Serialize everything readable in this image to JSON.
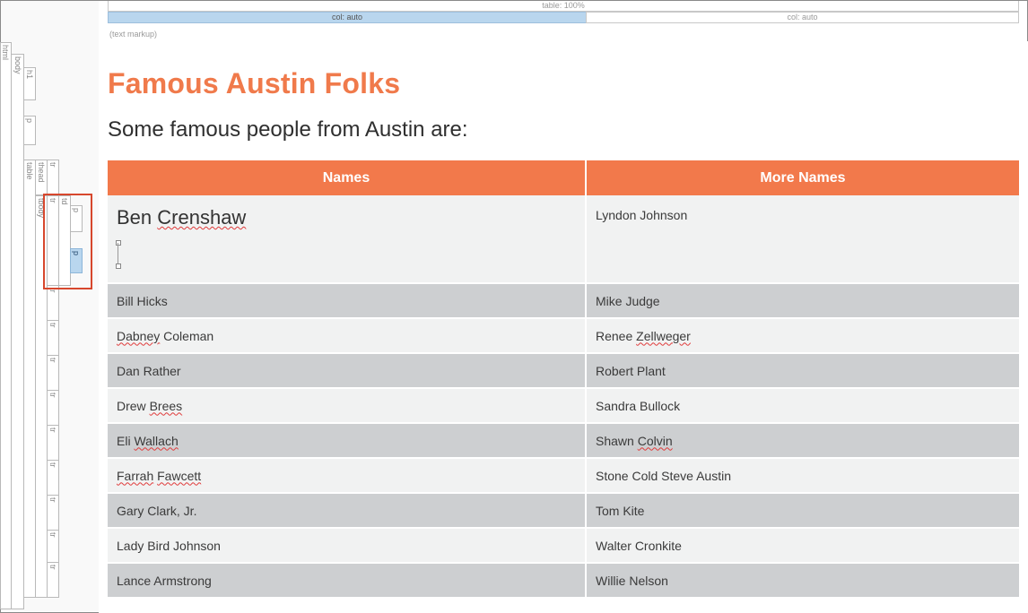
{
  "markup": {
    "table_label": "table: 100%",
    "col1_label": "col: auto",
    "col2_label": "col: auto",
    "text_markup_label": "(text markup)"
  },
  "structure_tags": {
    "html": "html",
    "body": "body",
    "h1": "h1",
    "p": "p",
    "table": "table",
    "thead": "thead",
    "tr": "tr",
    "tbody": "tbody",
    "td": "td"
  },
  "page": {
    "title": "Famous Austin Folks",
    "intro": "Some famous people from Austin are:"
  },
  "table": {
    "headers": [
      "Names",
      "More Names"
    ],
    "first_row": {
      "left_first": "Ben",
      "left_second": "Crenshaw",
      "right": "Lyndon Johnson"
    },
    "rows": [
      {
        "left": "Bill Hicks",
        "right": "Mike Judge"
      },
      {
        "left_a": "Dabney",
        "left_b": " Coleman",
        "right_a": "Renee ",
        "right_b": "Zellweger"
      },
      {
        "left": "Dan Rather",
        "right": "Robert Plant"
      },
      {
        "left_a": "Drew ",
        "left_b": "Brees",
        "right": "Sandra Bullock"
      },
      {
        "left_a": "Eli ",
        "left_b": "Wallach",
        "right_a": "Shawn ",
        "right_b": "Colvin"
      },
      {
        "left_a": "Farrah",
        "left_b": "Fawcett",
        "right": "Stone Cold Steve Austin"
      },
      {
        "left": "Gary Clark, Jr.",
        "right": "Tom Kite"
      },
      {
        "left": "Lady Bird Johnson",
        "right": "Walter Cronkite"
      },
      {
        "left": "Lance Armstrong",
        "right": "Willie Nelson"
      }
    ]
  },
  "colors": {
    "accent": "#f2794b",
    "row_light": "#f1f2f2",
    "row_dark": "#cdcfd1",
    "selected_tag": "#b9d6ee",
    "selection_outline": "#d7472d"
  }
}
